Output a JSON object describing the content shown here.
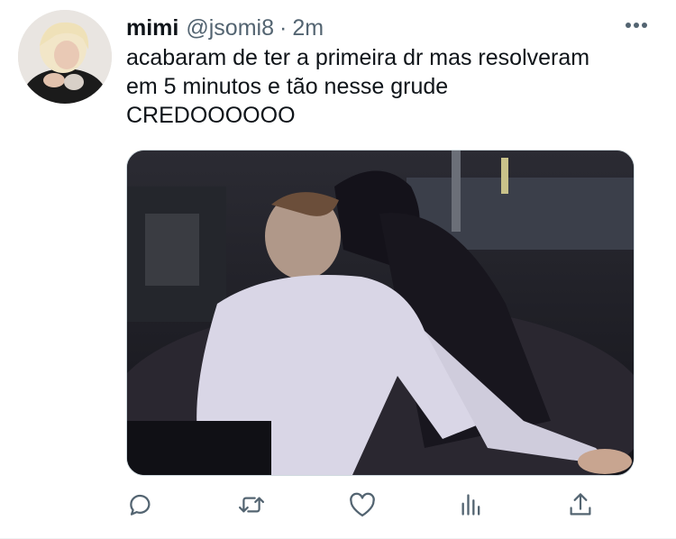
{
  "tweet": {
    "author": {
      "display_name": "mimi",
      "handle": "@jsomi8"
    },
    "separator": "·",
    "time": "2m",
    "text_lines": [
      "acabaram de ter a primeira dr mas resolveram",
      "em 5 minutos e tão nesse grude",
      "CREDOOOOOO"
    ]
  },
  "icons": {
    "more": "more-horizontal-icon",
    "reply": "reply-icon",
    "retweet": "retweet-icon",
    "like": "like-icon",
    "analytics": "analytics-icon",
    "share": "share-icon"
  },
  "colors": {
    "text": "#0f1419",
    "secondary": "#536471",
    "border": "#cfd9de"
  }
}
